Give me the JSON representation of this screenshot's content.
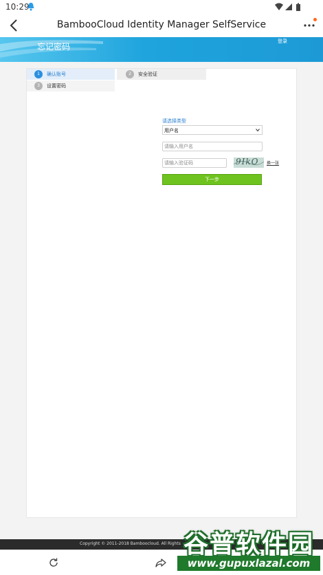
{
  "status_bar": {
    "time": "10:29",
    "icons": [
      "qq-bell-icon",
      "wifi-icon",
      "signal-icon",
      "battery-icon"
    ]
  },
  "app_bar": {
    "title": "BambooCloud Identity Manager SelfService",
    "back_icon": "back-arrow-icon",
    "more_icon": "more-dots-icon",
    "badge_color": "#ff6a1a"
  },
  "banner": {
    "title": "忘记密码",
    "login_link": "登录",
    "color": "#1fa4dd"
  },
  "steps": [
    {
      "number": "1",
      "label": "确认账号",
      "active": true
    },
    {
      "number": "2",
      "label": "安全验证",
      "active": false
    },
    {
      "number": "3",
      "label": "设置密码",
      "active": false
    }
  ],
  "form": {
    "type_label": "请选择类型",
    "type_value": "用户名",
    "username_placeholder": "请输入用户名",
    "captcha_placeholder": "请输入验证码",
    "captcha_text": "9IkO",
    "refresh_link": "换一张",
    "next_button": "下一步",
    "button_color": "#6ec31e"
  },
  "footer": {
    "copyright": "Copyright © 2011-2018 Bamboocloud. All Rights"
  },
  "toolbar": {
    "icons": [
      "refresh-icon",
      "share-icon"
    ]
  },
  "watermark": {
    "title": "谷普软件园",
    "url": "www.gupuxlazal.com"
  }
}
